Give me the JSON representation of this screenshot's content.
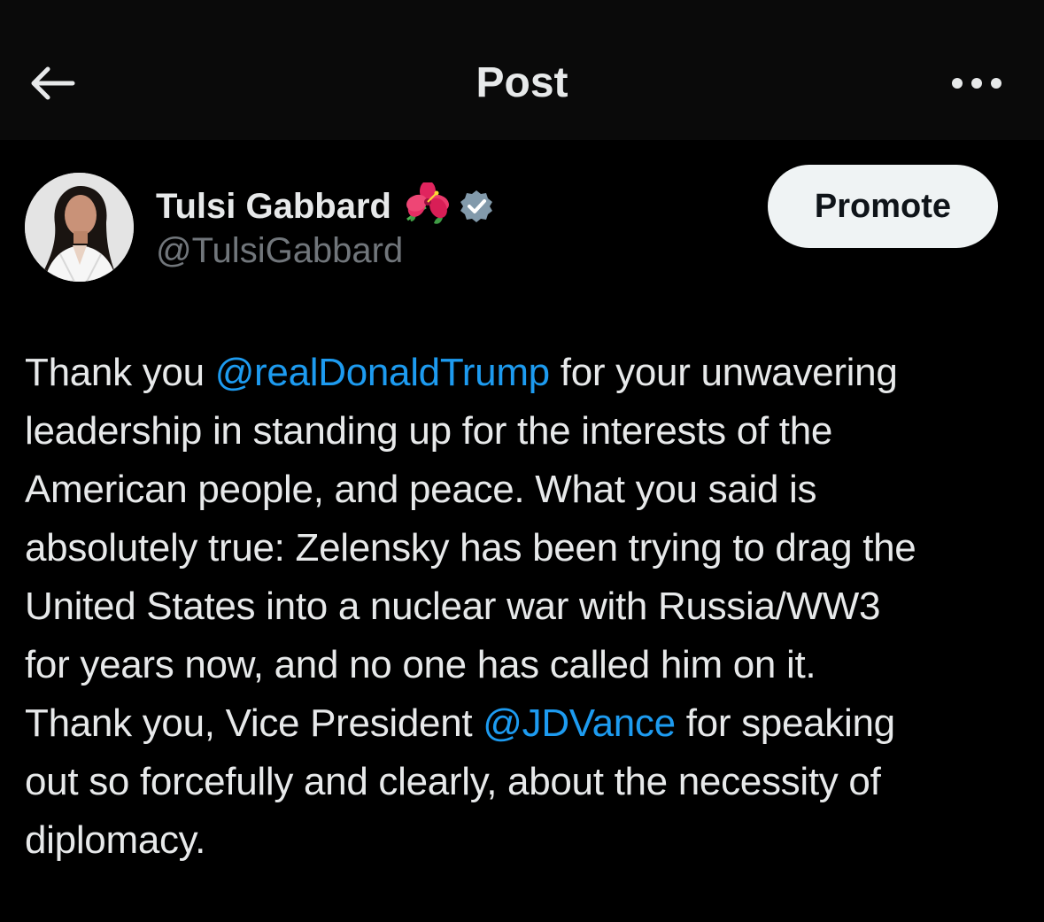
{
  "header": {
    "title": "Post",
    "back_icon": "arrow-left-icon",
    "more_icon": "more-horizontal-icon"
  },
  "author": {
    "display_name": "Tulsi Gabbard",
    "emoji_icon": "hibiscus-icon",
    "verified_icon": "verified-badge-icon",
    "handle": "@TulsiGabbard"
  },
  "actions": {
    "promote_label": "Promote"
  },
  "post": {
    "lines": [
      {
        "pre": "Thank you ",
        "mention": "@realDonaldTrump",
        "post": " for your unwavering"
      },
      {
        "text": "leadership in standing up for the interests of the"
      },
      {
        "text": "American people, and peace. What you said is"
      },
      {
        "text": "absolutely true: Zelensky has been trying to drag the"
      },
      {
        "text": "United States into a nuclear war with Russia/WW3"
      },
      {
        "text": "for years now, and no one has called him on it."
      },
      {
        "pre": "Thank you, Vice President ",
        "mention": "@JDVance",
        "post": " for speaking"
      },
      {
        "text": "out so forcefully and clearly, about the necessity of"
      },
      {
        "text": "diplomacy."
      }
    ]
  },
  "colors": {
    "background": "#000000",
    "header_background": "#0a0a0a",
    "text": "#e7e9ea",
    "secondary_text": "#71767b",
    "link": "#1d9bf0",
    "verified": "#829aab",
    "button_background": "#eff3f4"
  }
}
